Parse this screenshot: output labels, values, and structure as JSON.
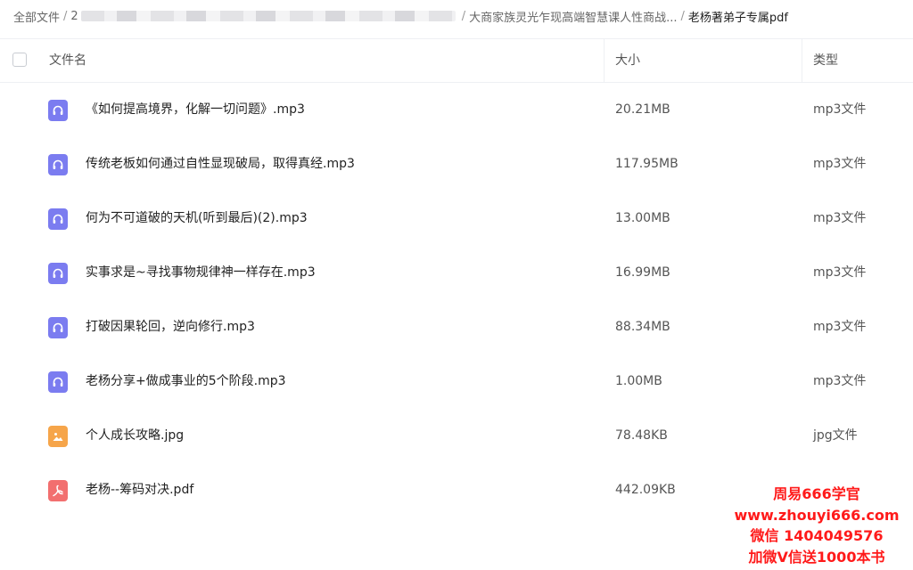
{
  "breadcrumb": {
    "root": "全部文件",
    "first_char": "2",
    "parent": "大商家族灵光乍现高端智慧课人性商战...",
    "current": "老杨著弟子专属pdf",
    "separator": "/"
  },
  "header": {
    "name": "文件名",
    "size": "大小",
    "type": "类型"
  },
  "files": [
    {
      "name": "《如何提高境界，化解一切问题》.mp3",
      "size": "20.21MB",
      "type": "mp3文件",
      "icon": "audio-file-icon"
    },
    {
      "name": "传统老板如何通过自性显现破局，取得真经.mp3",
      "size": "117.95MB",
      "type": "mp3文件",
      "icon": "audio-file-icon"
    },
    {
      "name": "何为不可道破的天机(听到最后)(2).mp3",
      "size": "13.00MB",
      "type": "mp3文件",
      "icon": "audio-file-icon"
    },
    {
      "name": "实事求是~寻找事物规律神一样存在.mp3",
      "size": "16.99MB",
      "type": "mp3文件",
      "icon": "audio-file-icon"
    },
    {
      "name": "打破因果轮回，逆向修行.mp3",
      "size": "88.34MB",
      "type": "mp3文件",
      "icon": "audio-file-icon"
    },
    {
      "name": "老杨分享+做成事业的5个阶段.mp3",
      "size": "1.00MB",
      "type": "mp3文件",
      "icon": "audio-file-icon"
    },
    {
      "name": "个人成长攻略.jpg",
      "size": "78.48KB",
      "type": "jpg文件",
      "icon": "image-file-icon"
    },
    {
      "name": "老杨--筹码对决.pdf",
      "size": "442.09KB",
      "type": "",
      "icon": "pdf-file-icon"
    }
  ],
  "watermark": {
    "line1": "周易666学官",
    "line2": "www.zhouyi666.com",
    "line3": "微信 1404049576",
    "line4": "加微V信送1000本书"
  },
  "colors": {
    "audio_icon": "#7b7cf0",
    "image_icon": "#f6a54a",
    "pdf_icon": "#f26f6f",
    "watermark": "#ff1a1a"
  }
}
